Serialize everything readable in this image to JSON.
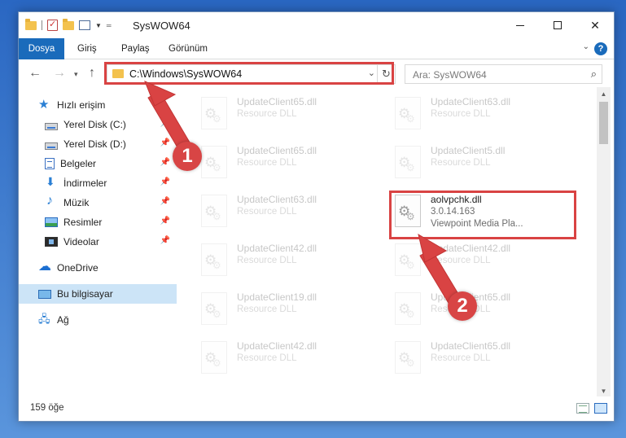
{
  "window": {
    "title": "SysWOW64"
  },
  "ribbon": {
    "tabs": [
      "Dosya",
      "Giriş",
      "Paylaş",
      "Görünüm"
    ]
  },
  "address": {
    "path": "C:\\Windows\\SysWOW64"
  },
  "search": {
    "placeholder": "Ara: SysWOW64"
  },
  "sidebar": {
    "items": [
      {
        "label": "Hızlı erişim",
        "icon": "star-icon"
      },
      {
        "label": "Yerel Disk (C:)",
        "icon": "disk-icon"
      },
      {
        "label": "Yerel Disk (D:)",
        "icon": "disk-icon"
      },
      {
        "label": "Belgeler",
        "icon": "document-icon"
      },
      {
        "label": "İndirmeler",
        "icon": "download-icon"
      },
      {
        "label": "Müzik",
        "icon": "music-icon"
      },
      {
        "label": "Resimler",
        "icon": "pictures-icon"
      },
      {
        "label": "Videolar",
        "icon": "video-icon"
      },
      {
        "label": "OneDrive",
        "icon": "cloud-icon"
      },
      {
        "label": "Bu bilgisayar",
        "icon": "computer-icon"
      },
      {
        "label": "Ağ",
        "icon": "network-icon"
      }
    ]
  },
  "files": {
    "left": [
      {
        "name": "UpdateClient65.dll",
        "desc": "Resource DLL"
      },
      {
        "name": "UpdateClient65.dll",
        "desc": "Resource DLL"
      },
      {
        "name": "UpdateClient63.dll",
        "desc": "Resource DLL"
      },
      {
        "name": "UpdateClient42.dll",
        "desc": "Resource DLL"
      },
      {
        "name": "UpdateClient19.dll",
        "desc": "Resource DLL"
      },
      {
        "name": "UpdateClient42.dll",
        "desc": "Resource DLL"
      }
    ],
    "right": [
      {
        "name": "UpdateClient63.dll",
        "desc": "Resource DLL"
      },
      {
        "name": "UpdateClient5.dll",
        "desc": "Resource DLL"
      },
      {
        "name": "UpdateClient42.dll",
        "desc": "Resource DLL"
      },
      {
        "name": "UpdateClient65.dll",
        "desc": "Resource DLL"
      },
      {
        "name": "UpdateClient65.dll",
        "desc": "Resource DLL"
      }
    ],
    "highlighted": {
      "name": "aolvpchk.dll",
      "version": "3.0.14.163",
      "desc": "Viewpoint Media Pla..."
    }
  },
  "status": {
    "count": "159 öğe"
  },
  "annotations": {
    "step1": "1",
    "step2": "2",
    "color": "#d94343"
  }
}
